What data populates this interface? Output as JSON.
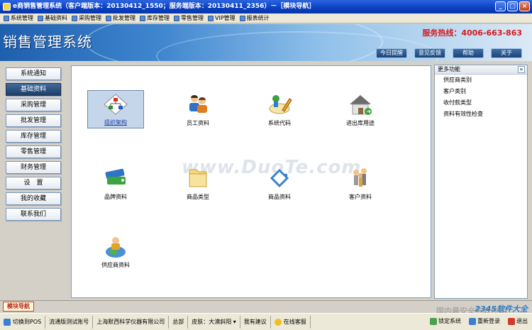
{
  "window": {
    "title": "e商销售管理系统（客户端版本：20130412_1550；服务端版本：20130411_2356）－［模块导航］"
  },
  "menu": [
    "系统管理",
    "基础资料",
    "采购管理",
    "批发管理",
    "库存管理",
    "零售管理",
    "VIP管理",
    "报表统计"
  ],
  "banner": {
    "title": "销售管理系统",
    "hotline": "服务热线：4006-663-863",
    "buttons": [
      "今日提醒",
      "意见反馈",
      "帮助",
      "关于"
    ]
  },
  "nav": [
    "系统通知",
    "基础资料",
    "采购管理",
    "批发管理",
    "库存管理",
    "零售管理",
    "财务管理",
    "设　置",
    "我的收藏",
    "联系我们"
  ],
  "tiles": [
    {
      "label": "组织架构",
      "icon": "org-chart-icon"
    },
    {
      "label": "员工资料",
      "icon": "employees-icon"
    },
    {
      "label": "系统代码",
      "icon": "code-pencil-icon"
    },
    {
      "label": "进出库用途",
      "icon": "warehouse-icon"
    },
    {
      "label": "品牌资料",
      "icon": "brand-tags-icon"
    },
    {
      "label": "商品类型",
      "icon": "folder-icon"
    },
    {
      "label": "商品资料",
      "icon": "product-icon"
    },
    {
      "label": "客户资料",
      "icon": "customers-icon"
    },
    {
      "label": "供应商资料",
      "icon": "supplier-globe-icon"
    }
  ],
  "watermark": "www.DuoTe.com",
  "more_panel": {
    "title": "更多功能",
    "toggle": "»",
    "items": [
      "供应商类别",
      "客户类别",
      "收付款类型",
      "资料有效性检查"
    ]
  },
  "bottom_tab": "模块导航",
  "status": {
    "cells": [
      "切换到POS",
      "流通版测试账号",
      "上海默西科学仪器有限公司",
      "总部",
      "皮肤：大漠斜阳 ▾",
      "我有建议",
      "在线客服"
    ],
    "right": [
      "锁定系统",
      "重新登录",
      "退出"
    ]
  },
  "site_watermark": "2345软件大全",
  "site_watermark_sub": "国内最安全的软件站",
  "colors": {
    "accent": "#1e5fae",
    "hotline": "#d21c1c",
    "nav_active": "#1f3e66"
  }
}
